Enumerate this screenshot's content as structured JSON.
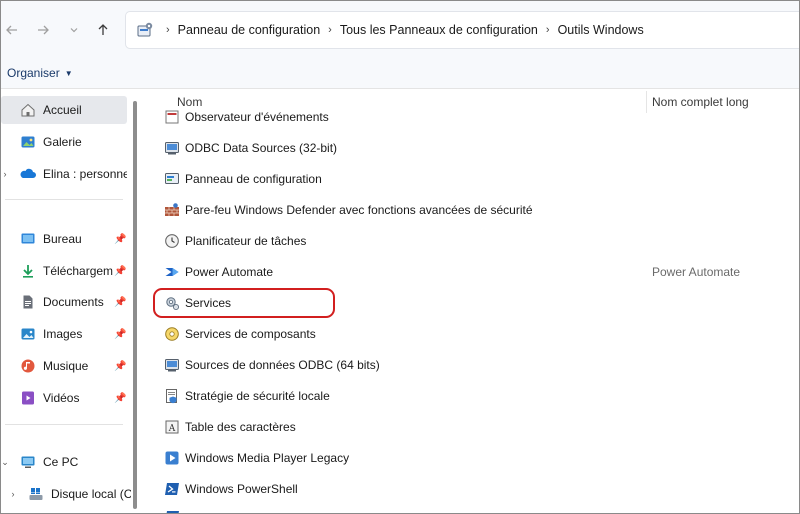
{
  "nav": {
    "back_icon": "arrow-left-icon",
    "forward_icon": "arrow-right-icon",
    "recent_icon": "chevron-down-icon",
    "up_icon": "arrow-up-icon"
  },
  "address": {
    "crumbs": [
      "Panneau de configuration",
      "Tous les Panneaux de configuration",
      "Outils Windows"
    ]
  },
  "cmdbar": {
    "organiser_label": "Organiser"
  },
  "sidebar": {
    "items": [
      {
        "label": "Accueil",
        "icon": "home-icon"
      },
      {
        "label": "Galerie",
        "icon": "gallery-icon"
      },
      {
        "label": "Elina : personne",
        "icon": "onedrive-icon"
      },
      {
        "label": "Bureau",
        "icon": "desktop-icon"
      },
      {
        "label": "Téléchargem",
        "icon": "download-icon"
      },
      {
        "label": "Documents",
        "icon": "documents-icon"
      },
      {
        "label": "Images",
        "icon": "images-icon"
      },
      {
        "label": "Musique",
        "icon": "music-icon"
      },
      {
        "label": "Vidéos",
        "icon": "videos-icon"
      },
      {
        "label": "Ce PC",
        "icon": "pc-icon"
      },
      {
        "label": "Disque local (C",
        "icon": "drive-icon"
      }
    ]
  },
  "columns": {
    "name": "Nom",
    "long_name": "Nom complet long"
  },
  "rows": [
    {
      "name": "Observateur d'événements",
      "long": ""
    },
    {
      "name": "ODBC Data Sources (32-bit)",
      "long": ""
    },
    {
      "name": "Panneau de configuration",
      "long": ""
    },
    {
      "name": "Pare-feu Windows Defender avec fonctions avancées de sécurité",
      "long": ""
    },
    {
      "name": "Planificateur de tâches",
      "long": ""
    },
    {
      "name": "Power Automate",
      "long": "Power Automate"
    },
    {
      "name": "Services",
      "long": ""
    },
    {
      "name": "Services de composants",
      "long": ""
    },
    {
      "name": "Sources de données ODBC (64 bits)",
      "long": ""
    },
    {
      "name": "Stratégie de sécurité locale",
      "long": ""
    },
    {
      "name": "Table des caractères",
      "long": ""
    },
    {
      "name": "Windows Media Player Legacy",
      "long": ""
    },
    {
      "name": "Windows PowerShell",
      "long": ""
    }
  ],
  "colors": {
    "highlight": "#d21f1f",
    "accent": "#1a3a6a"
  }
}
